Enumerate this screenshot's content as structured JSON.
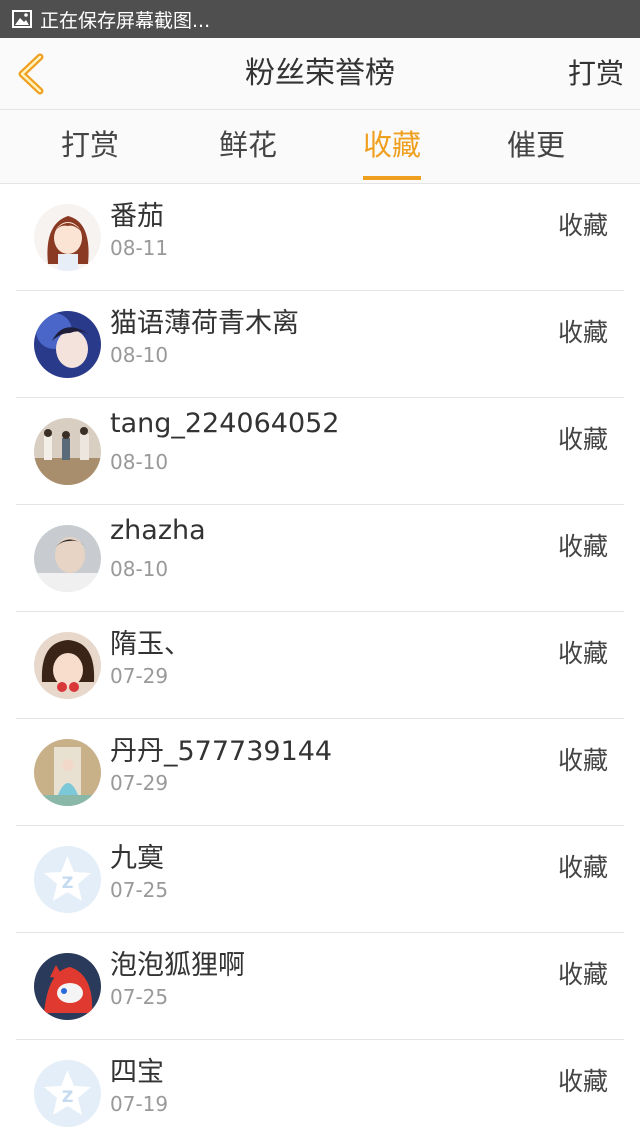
{
  "status_bar": {
    "text": "正在保存屏幕截图..."
  },
  "header": {
    "title": "粉丝荣誉榜",
    "right_label": "打赏"
  },
  "tabs": [
    {
      "label": "打赏",
      "active": false
    },
    {
      "label": "鲜花",
      "active": false
    },
    {
      "label": "收藏",
      "active": true
    },
    {
      "label": "催更",
      "active": false
    }
  ],
  "accent_color": "#f0a020",
  "rows": [
    {
      "name": "番茄",
      "date": "08-11",
      "action": "收藏"
    },
    {
      "name": "猫语薄荷青木离",
      "date": "08-10",
      "action": "收藏"
    },
    {
      "name": "tang_224064052",
      "date": "08-10",
      "action": "收藏"
    },
    {
      "name": "zhazha",
      "date": "08-10",
      "action": "收藏"
    },
    {
      "name": "隋玉、",
      "date": "07-29",
      "action": "收藏"
    },
    {
      "name": "丹丹_577739144",
      "date": "07-29",
      "action": "收藏"
    },
    {
      "name": "九寞",
      "date": "07-25",
      "action": "收藏"
    },
    {
      "name": "泡泡狐狸啊",
      "date": "07-25",
      "action": "收藏"
    },
    {
      "name": "四宝",
      "date": "07-19",
      "action": "收藏"
    }
  ]
}
